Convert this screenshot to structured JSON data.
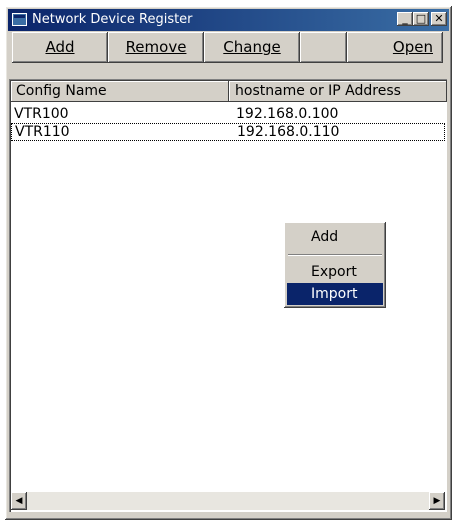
{
  "window": {
    "title": "Network Device Register",
    "controls": {
      "minimize": "_",
      "maximize": "□",
      "close": "✕"
    }
  },
  "toolbar": {
    "add": "Add",
    "remove": "Remove",
    "change": "Change",
    "open": "Open"
  },
  "table": {
    "columns": [
      "Config Name",
      "hostname or IP Address"
    ],
    "rows": [
      {
        "config_name": "VTR100",
        "host": "192.168.0.100"
      },
      {
        "config_name": "VTR110",
        "host": "192.168.0.110"
      }
    ]
  },
  "context_menu": {
    "items": [
      "Add",
      "Export",
      "Import"
    ],
    "highlighted": "Import"
  },
  "scrollbar": {
    "left": "◀",
    "right": "▶"
  },
  "colors": {
    "titlebar_start": "#0a246a",
    "titlebar_end": "#3a6ea5",
    "face": "#d4d0c8",
    "highlight": "#0a246a"
  }
}
